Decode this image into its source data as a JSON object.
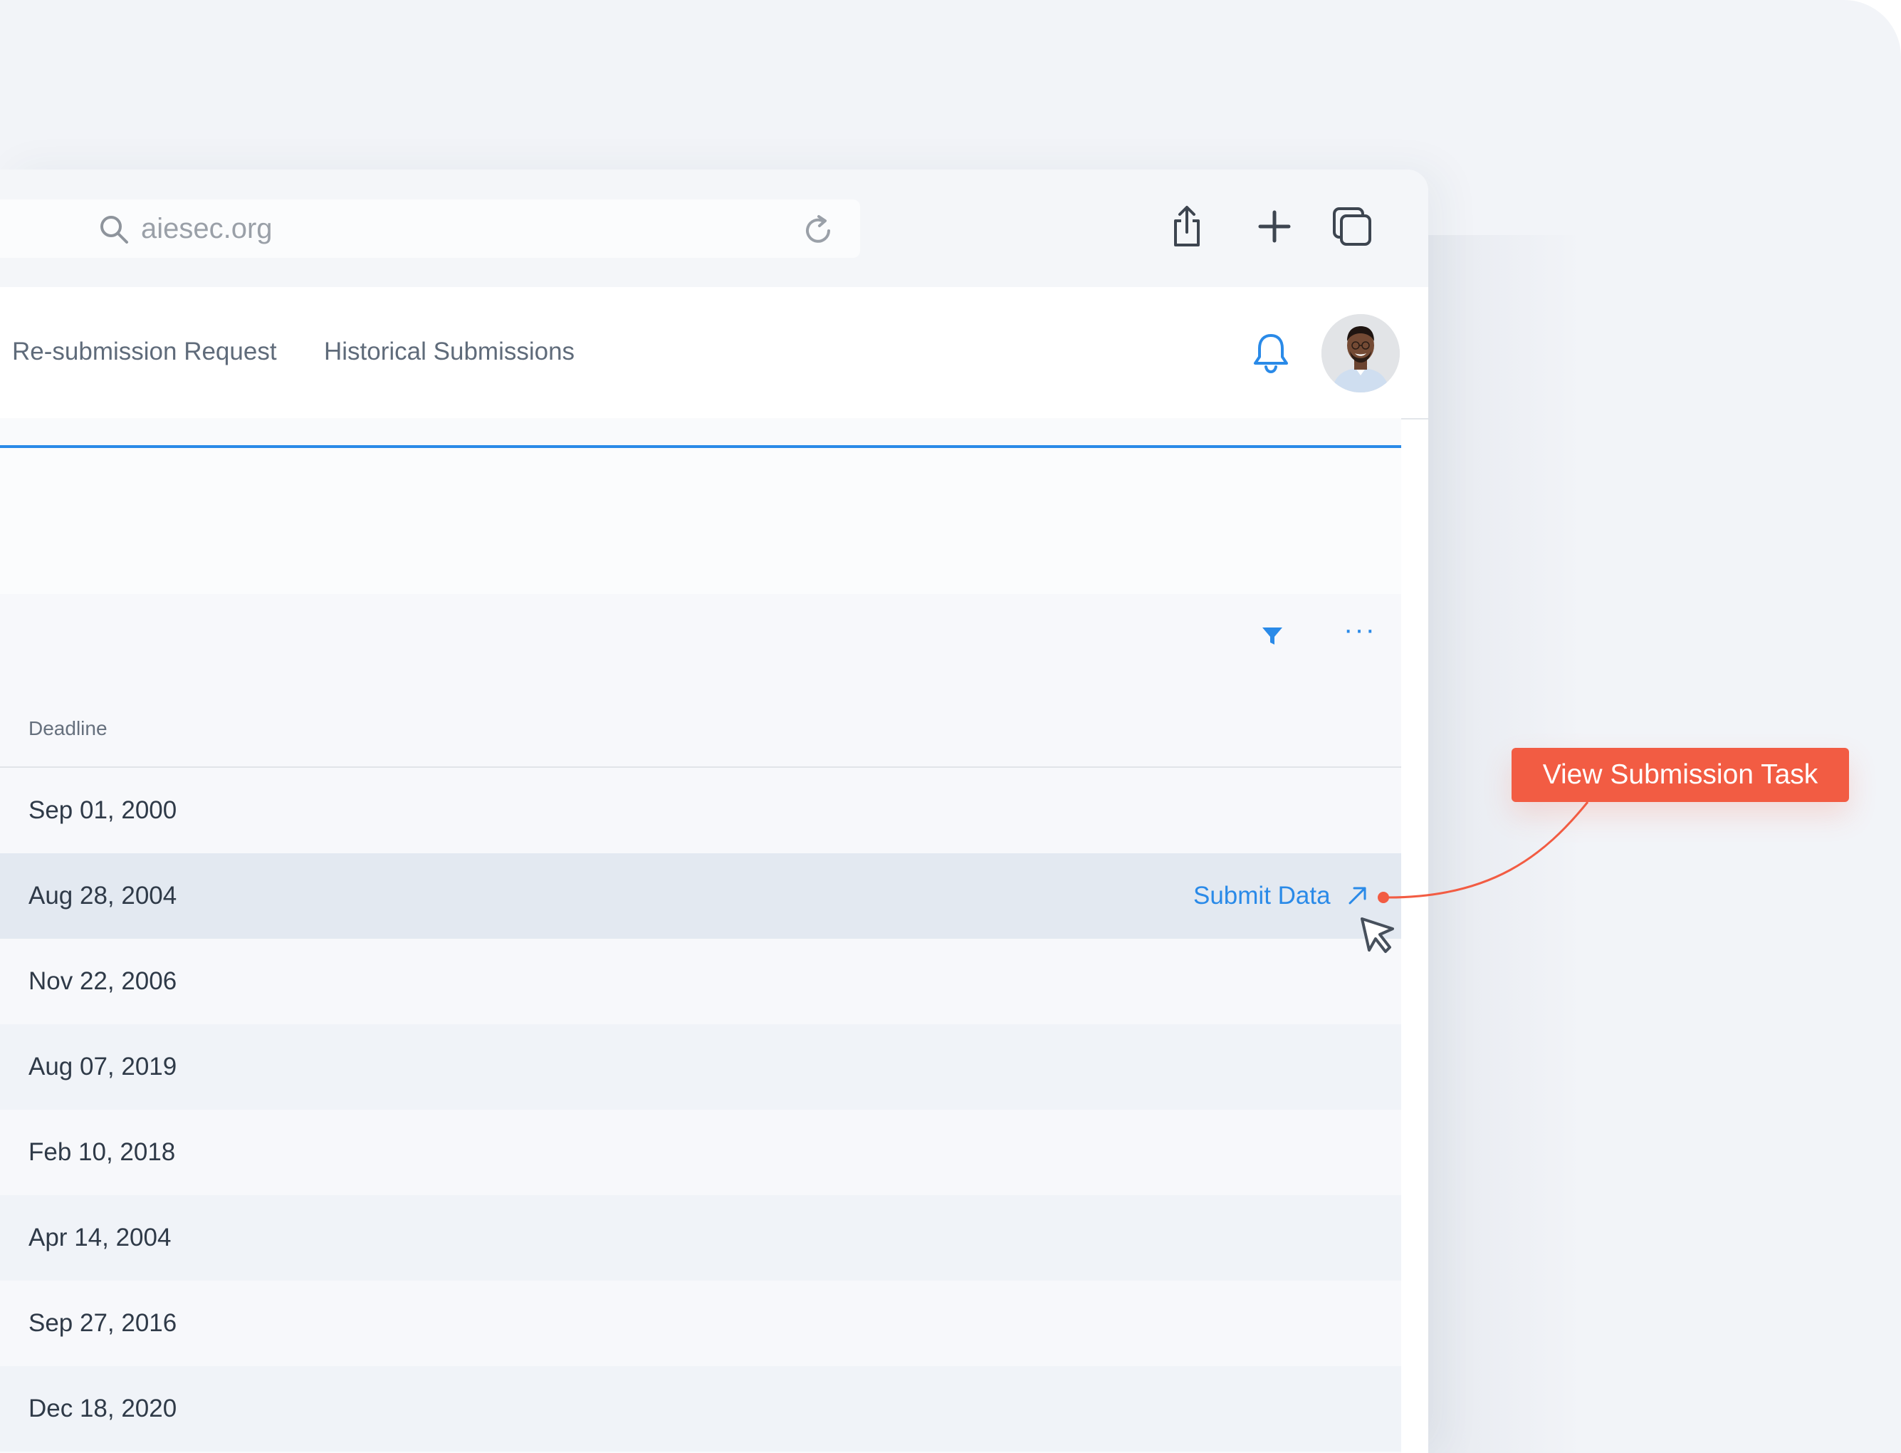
{
  "browser": {
    "address": "aiesec.org",
    "icons": [
      "search-icon",
      "reload-icon",
      "share-icon",
      "new-tab-icon",
      "tabs-icon"
    ]
  },
  "nav": {
    "tabs": [
      {
        "label": "Re-submission Request"
      },
      {
        "label": "Historical Submissions"
      }
    ],
    "icons": [
      "bell-icon",
      "avatar"
    ]
  },
  "table": {
    "toolbar_icons": [
      "filter-icon",
      "more-icon"
    ],
    "columns": {
      "deadline": "Deadline"
    },
    "rows": [
      {
        "deadline": "Sep 01, 2000"
      },
      {
        "deadline": "Aug 28, 2004",
        "action": "Submit Data"
      },
      {
        "deadline": "Nov 22, 2006"
      },
      {
        "deadline": "Aug 07, 2019"
      },
      {
        "deadline": "Feb 10, 2018"
      },
      {
        "deadline": "Apr 14, 2004"
      },
      {
        "deadline": "Sep 27, 2016"
      },
      {
        "deadline": "Dec 18, 2020"
      }
    ],
    "more_glyph": "···"
  },
  "callout": {
    "label": "View Submission Task"
  },
  "colors": {
    "accent": "#2a8ae8",
    "callout": "#f25c43",
    "row_hover": "#e3e9f1",
    "text": "#2f3a48"
  }
}
